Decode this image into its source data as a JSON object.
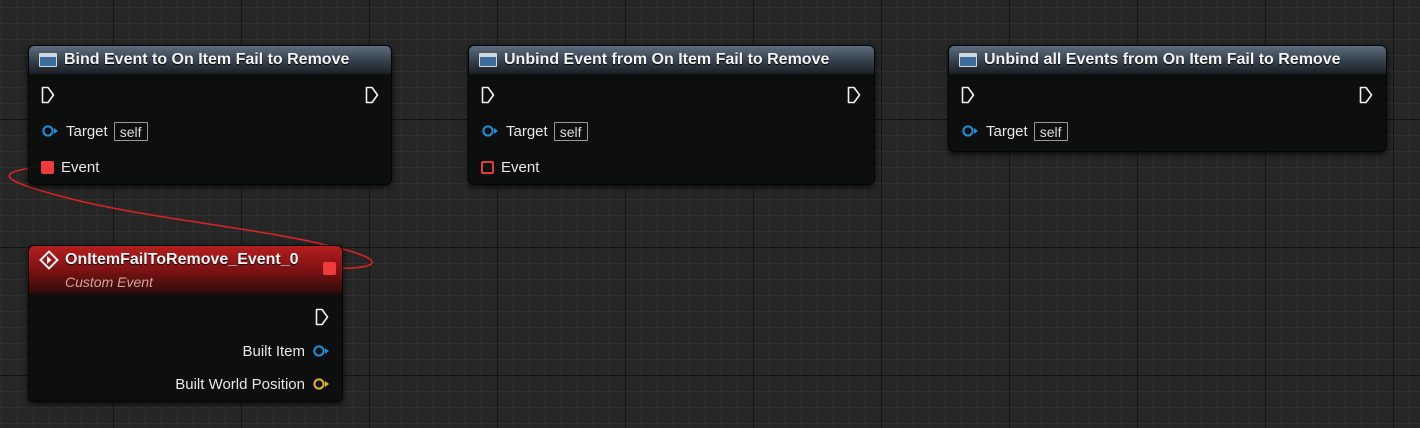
{
  "nodes": {
    "bind": {
      "title": "Bind Event to On Item Fail to Remove",
      "target_label": "Target",
      "target_default": "self",
      "event_label": "Event"
    },
    "unbind": {
      "title": "Unbind Event from On Item Fail to Remove",
      "target_label": "Target",
      "target_default": "self",
      "event_label": "Event"
    },
    "unbind_all": {
      "title": "Unbind all Events from On Item Fail to Remove",
      "target_label": "Target",
      "target_default": "self"
    },
    "custom_event": {
      "title": "OnItemFailToRemove_Event_0",
      "subtitle": "Custom Event",
      "outputs": [
        "Built Item",
        "Built World Position"
      ]
    }
  },
  "colors": {
    "delegate_pin": "#ee3b3b",
    "object_pin": "#1e8fd6",
    "vector_pin": "#e6b422",
    "wire": "#d82424",
    "function_header": "#3a4654",
    "event_header": "#9e1818"
  },
  "icons": {
    "function": "function-icon",
    "event": "custom-event-icon",
    "exec": "exec-pin-icon"
  }
}
